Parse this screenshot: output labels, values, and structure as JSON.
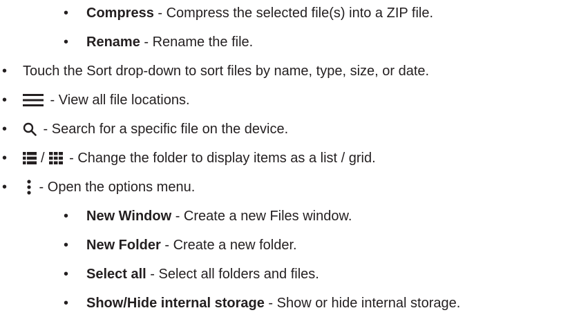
{
  "items": [
    {
      "term": "Compress",
      "desc": " - Compress the selected file(s) into a ZIP file."
    },
    {
      "term": "Rename",
      "desc": " - Rename the file."
    },
    {
      "text": "Touch the Sort drop-down to sort files by name, type, size, or date."
    },
    {
      "icon": "hamburger-menu-icon",
      "text": " - View all file locations."
    },
    {
      "icon": "search-icon",
      "text": " - Search for a specific file on the device."
    },
    {
      "icons": [
        "list-view-icon",
        "grid-view-icon"
      ],
      "separator": "/",
      "text": " - Change the folder to display items as a list / grid."
    },
    {
      "icon": "more-options-icon",
      "text": " - Open the options menu."
    },
    {
      "term": "New Window",
      "desc": " - Create a new Files window."
    },
    {
      "term": "New Folder",
      "desc": " - Create a new folder."
    },
    {
      "term": "Select all",
      "desc": " - Select all folders and files."
    },
    {
      "term": "Show/Hide internal storage",
      "desc": " - Show or hide internal storage."
    }
  ],
  "bullet": "•"
}
